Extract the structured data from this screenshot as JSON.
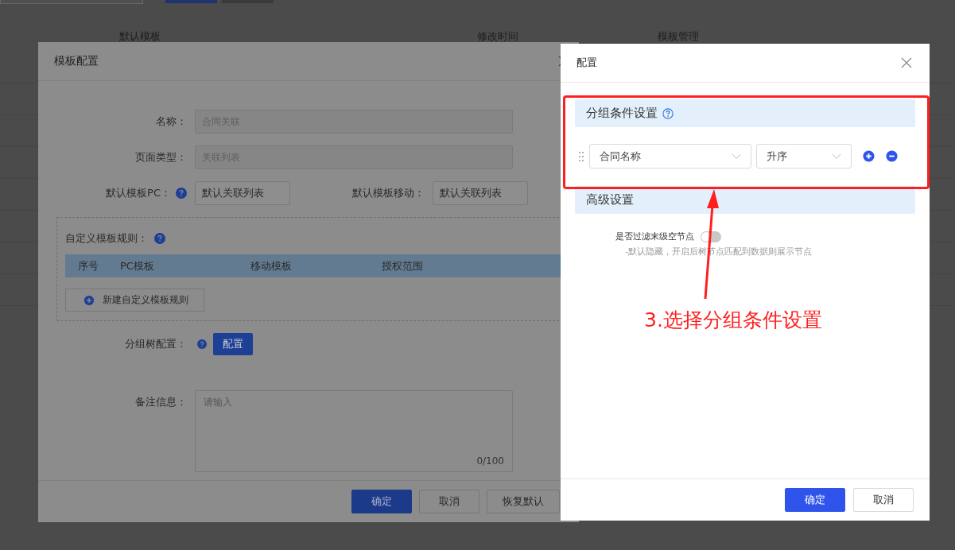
{
  "background_page": {
    "columns": [
      "默认模板",
      "修改时间",
      "模板管理"
    ]
  },
  "template_dialog": {
    "title": "模板配置",
    "fields": [
      {
        "label": "名称：",
        "value": "合同关联",
        "disabled": true
      },
      {
        "label": "页面类型：",
        "value": "关联列表",
        "disabled": true
      }
    ],
    "default_pc": {
      "label": "默认模板PC：",
      "value": "默认关联列表",
      "disabled": false
    },
    "default_mobile": {
      "label": "默认模板移动：",
      "value": "默认关联列表",
      "disabled": false
    },
    "custom_rules": {
      "title": "自定义模板规则：",
      "columns": [
        "序号",
        "PC模板",
        "移动模板",
        "授权范围"
      ],
      "add_button": "新建自定义模板规则"
    },
    "group_tree": {
      "label": "分组树配置：",
      "button": "配置"
    },
    "remarks": {
      "label": "备注信息：",
      "placeholder": "请输入",
      "counter": "0/100"
    },
    "buttons": [
      {
        "label": "确定",
        "kind": "primary"
      },
      {
        "label": "取消",
        "kind": "default"
      },
      {
        "label": "恢复默认",
        "kind": "default"
      }
    ]
  },
  "config_drawer": {
    "title": "配置",
    "group_section": {
      "title": "分组条件设置",
      "conditions": [
        {
          "field": "合同名称",
          "order": "升序"
        }
      ]
    },
    "advanced_section": {
      "title": "高级设置",
      "filter_toggle": {
        "label": "是否过滤末级空节点",
        "on": false,
        "hint": "-默认隐藏，开启后树节点匹配到数据则展示节点"
      }
    },
    "buttons": [
      {
        "label": "确定",
        "kind": "primary"
      },
      {
        "label": "取消",
        "kind": "default"
      }
    ]
  },
  "annotation": {
    "text": "3.选择分组条件设置"
  }
}
